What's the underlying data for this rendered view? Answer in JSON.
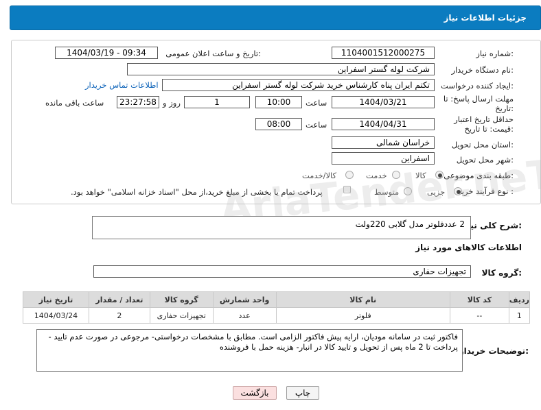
{
  "header": {
    "title": "جزئیات اطلاعات نیاز"
  },
  "form": {
    "need_number": {
      "label": "شماره نیاز:",
      "value": "1104001512000275"
    },
    "announce_datetime": {
      "label": "تاریخ و ساعت اعلان عمومی:",
      "value": "1404/03/19 - 09:34"
    },
    "buyer_org": {
      "label": "نام دستگاه خریدار:",
      "value": "شرکت لوله گستر اسفراین"
    },
    "requester": {
      "label": "ایجاد کننده درخواست:",
      "value": "تکتم ایران پناه کارشناس خرید شرکت لوله گستر اسفراین"
    },
    "buyer_contact_link": "اطلاعات تماس خریدار",
    "reply_deadline": {
      "label": "مهلت ارسال پاسخ: تا تاریخ:",
      "date": "1404/03/21",
      "time_label": "ساعت",
      "time": "10:00",
      "days": "1",
      "days_label": "روز و",
      "remaining": "23:27:58",
      "remaining_label": "ساعت باقی مانده"
    },
    "price_validity": {
      "label": "حداقل تاریخ اعتبار قیمت: تا تاریخ:",
      "date": "1404/04/31",
      "time_label": "ساعت",
      "time": "08:00"
    },
    "province": {
      "label": "استان محل تحویل:",
      "value": "خراسان شمالی"
    },
    "city": {
      "label": "شهر محل تحویل:",
      "value": "اسفراین"
    },
    "category": {
      "label": "طبقه بندی موضوعی:",
      "options": [
        "کالا",
        "خدمت",
        "کالا/خدمت"
      ],
      "selected": "کالا"
    },
    "process_type": {
      "label": "نوع فرآیند خرید :",
      "options": [
        "جزیی",
        "متوسط"
      ],
      "selected": "جزیی",
      "payment_note": "پرداخت تمام یا بخشی از مبلغ خرید،از محل \"اسناد خزانه اسلامی\" خواهد بود."
    }
  },
  "description": {
    "label": "شرح کلی نیاز:",
    "value": "2 عددفلوتر مدل گلابی 220ولت"
  },
  "goods_info_title": "اطلاعات کالاهای مورد نیاز",
  "goods_group": {
    "label": "گروه کالا:",
    "value": "تجهیزات حفاری"
  },
  "table": {
    "headers": [
      "ردیف",
      "کد کالا",
      "نام کالا",
      "واحد شمارش",
      "گروه کالا",
      "تعداد / مقدار",
      "تاریخ نیاز"
    ],
    "rows": [
      [
        "1",
        "--",
        "فلوتر",
        "عدد",
        "تجهیزات حفاری",
        "2",
        "1404/03/24"
      ]
    ]
  },
  "buyer_notes": {
    "label": "توضیحات خریدار:",
    "value": "فاکتور ثبت در سامانه مودیان، ارایه پیش فاکتور الزامی است. مطابق با مشخصات درخواستی- مرجوعی در صورت عدم تایید - پرداخت تا 2 ماه پس از تحویل و تایید کالا در انبار- هزینه حمل با فروشنده"
  },
  "buttons": {
    "print": "چاپ",
    "back": "بازگشت"
  },
  "watermark": "AriaTender.neT"
}
